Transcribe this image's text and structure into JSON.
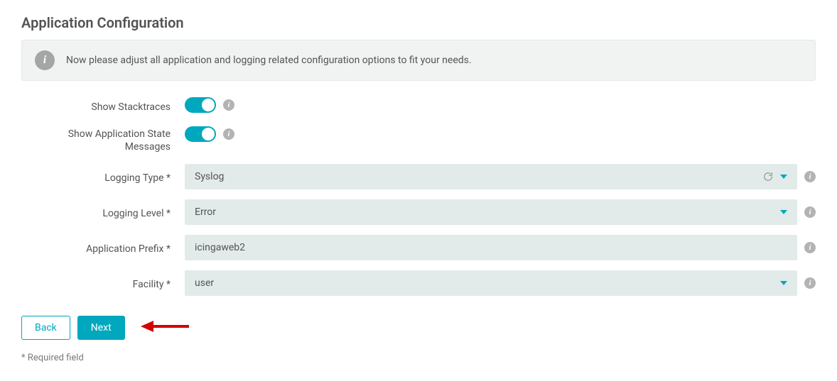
{
  "page": {
    "title": "Application Configuration",
    "info_text": "Now please adjust all application and logging related configuration options to fit your needs.",
    "required_note": "* Required field"
  },
  "fields": {
    "show_stacktraces": {
      "label": "Show Stacktraces",
      "value": true
    },
    "show_app_state_messages": {
      "label": "Show Application State Messages",
      "value": true
    },
    "logging_type": {
      "label": "Logging Type *",
      "value": "Syslog"
    },
    "logging_level": {
      "label": "Logging Level *",
      "value": "Error"
    },
    "application_prefix": {
      "label": "Application Prefix *",
      "value": "icingaweb2"
    },
    "facility": {
      "label": "Facility *",
      "value": "user"
    }
  },
  "buttons": {
    "back": "Back",
    "next": "Next"
  }
}
